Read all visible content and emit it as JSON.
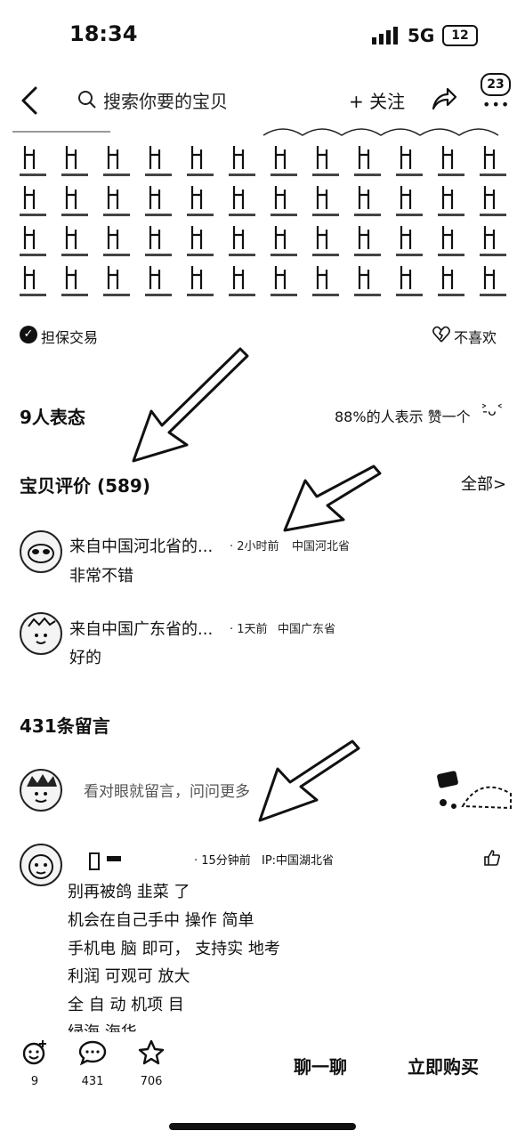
{
  "status_bar": {
    "time": "18:34",
    "network": "5G",
    "battery": "12"
  },
  "nav": {
    "search_placeholder": "搜索你要的宝贝",
    "follow_label": "+ 关注",
    "more_badge": "23"
  },
  "guarantee": {
    "label": "担保交易",
    "dislike_label": "不喜欢"
  },
  "attitude": {
    "title": "9人表态",
    "summary": "88%的人表示 赞一个"
  },
  "reviews": {
    "title": "宝贝评价 (589)",
    "all_label": "全部>",
    "items": [
      {
        "name": "来自中国河北省的...",
        "time": "· 2小时前",
        "location": "中国河北省",
        "text": "非常不错"
      },
      {
        "name": "来自中国广东省的...",
        "time": "· 1天前",
        "location": "中国广东省",
        "text": "好的"
      }
    ]
  },
  "messages": {
    "title": "431条留言",
    "placeholder": "看对眼就留言，问问更多",
    "comment": {
      "time": "· 15分钟前",
      "location": "IP:中国湖北省",
      "lines": [
        "别再被鸽 韭菜 了",
        "机会在自己手中 操作 简单",
        "手机电 脑 即可， 支持实 地考",
        "利润 可观可 放大",
        "全 自 动 机项 目",
        "绿海 海华"
      ]
    }
  },
  "bottom_bar": {
    "like_count": "9",
    "comment_count": "431",
    "favorite_count": "706",
    "chat_label": "聊一聊",
    "buy_label": "立即购买"
  }
}
